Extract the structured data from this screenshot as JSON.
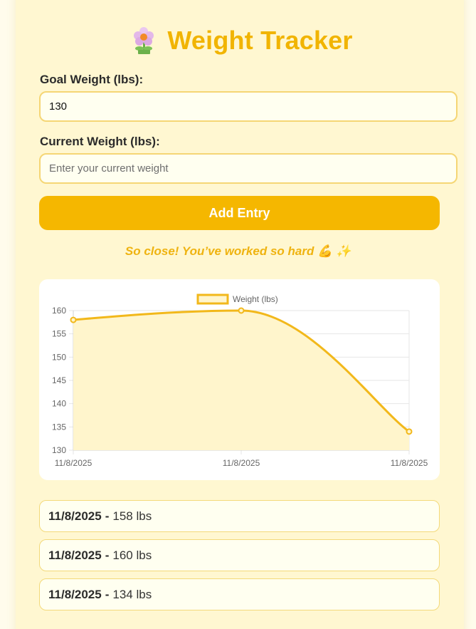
{
  "app": {
    "title": "Weight Tracker",
    "title_icon": "flower-icon",
    "accent_color": "#f5b700"
  },
  "form": {
    "goal_label": "Goal Weight (lbs):",
    "goal_value": "130",
    "current_label": "Current Weight (lbs):",
    "current_value": "",
    "current_placeholder": "Enter your current weight",
    "add_button_label": "Add Entry"
  },
  "message": "So close! You’ve worked so hard 💪 ✨",
  "chart_data": {
    "type": "area",
    "categories": [
      "11/8/2025",
      "11/8/2025",
      "11/8/2025"
    ],
    "series": [
      {
        "name": "Weight (lbs)",
        "values": [
          158,
          160,
          134
        ],
        "color": "#f2b81b"
      }
    ],
    "ylim": [
      130,
      160
    ],
    "yticks": [
      130,
      135,
      140,
      145,
      150,
      155,
      160
    ],
    "grid": true,
    "legend_position": "top"
  },
  "entries": [
    {
      "date": "11/8/2025",
      "weight": "158 lbs"
    },
    {
      "date": "11/8/2025",
      "weight": "160 lbs"
    },
    {
      "date": "11/8/2025",
      "weight": "134 lbs"
    }
  ]
}
